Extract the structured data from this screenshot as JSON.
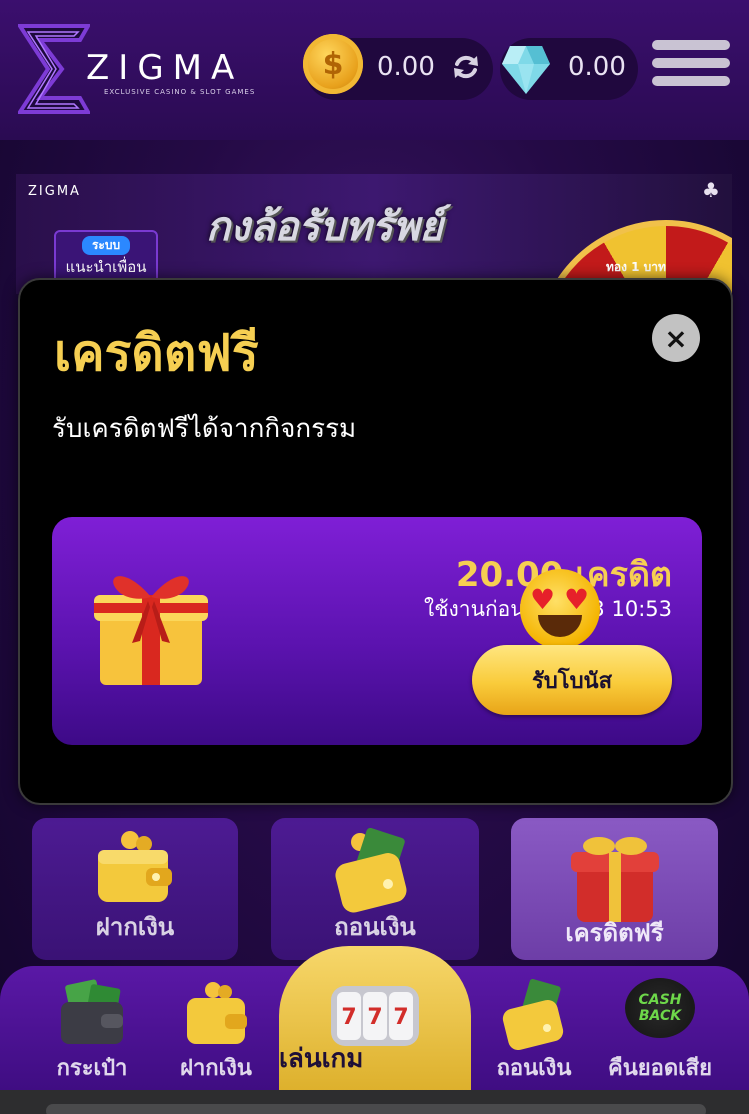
{
  "header": {
    "logo_word": "ZIGMA",
    "logo_subtitle": "EXCLUSIVE CASINO & SLOT GAMES",
    "coin_balance": "0.00",
    "gem_balance": "0.00"
  },
  "banner": {
    "logo": "ZIGMA",
    "tag_top": "ระบบ",
    "tag_bottom": "แนะนำเพื่อน",
    "title": "กงล้อรับทรัพย์",
    "wheel_label": "ทอง 1 บาท"
  },
  "modal": {
    "title": "เครดิตฟรี",
    "subtitle": "รับเครดิตฟรีได้จากกิจกรรม",
    "close_symbol": "×",
    "bonus": {
      "amount": "20.00 เครดิต",
      "expire": "ใช้งานก่อน 2023 3 10:53",
      "claim_label": "รับโบนัส"
    }
  },
  "tiles": [
    {
      "label": "ฝากเงิน",
      "icon": "wallet-icon"
    },
    {
      "label": "ถอนเงิน",
      "icon": "wallet-cash-icon"
    },
    {
      "label": "เครดิตฟรี",
      "icon": "gift-icon"
    }
  ],
  "bottom_nav": {
    "wallet": "กระเป๋า",
    "deposit": "ฝากเงิน",
    "play": "เล่นเกม",
    "withdraw": "ถอนเงิน",
    "cashback": "คืนยอดเสีย",
    "cashback_badge": "CASH BACK"
  },
  "colors": {
    "accent_gold": "#f6cf52",
    "purple_card": "#6a17c0",
    "modal_bg": "#000000"
  }
}
